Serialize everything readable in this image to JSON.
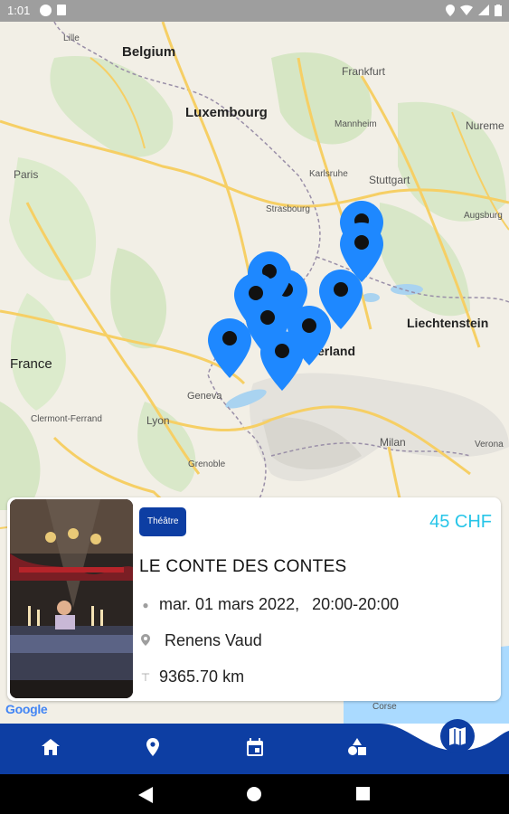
{
  "status_bar": {
    "time": "1:01"
  },
  "map": {
    "places": {
      "lille": "Lille",
      "belgium": "Belgium",
      "frankfurt": "Frankfurt",
      "luxembourg": "Luxembourg",
      "mannheim": "Mannheim",
      "nuremberg": "Nureme",
      "paris": "Paris",
      "karlsruhe": "Karlsruhe",
      "stuttgart": "Stuttgart",
      "strasbourg": "Strasbourg",
      "augsburg": "Augsburg",
      "liechtenstein": "Liechtenstein",
      "france": "France",
      "switzerland": "erland",
      "geneva": "Geneva",
      "clermont": "Clermont-Ferrand",
      "lyon": "Lyon",
      "milan": "Milan",
      "verona": "Verona",
      "grenoble": "Grenoble",
      "corse": "Corse"
    },
    "google_logo": "Google",
    "pin_color": "#1e88ff"
  },
  "event": {
    "category": "Théâtre",
    "price": "45 CHF",
    "title": "LE CONTE DES CONTES",
    "date": "mar. 01 mars 2022,",
    "time": "20:00-20:00",
    "location": "Renens Vaud",
    "distance": "9365.70 km"
  },
  "bottom_nav": {
    "tabs": [
      "home-icon",
      "location-icon",
      "calendar-icon",
      "categories-icon",
      "map-icon"
    ],
    "active": "map-icon",
    "color": "#0d3ea3"
  }
}
